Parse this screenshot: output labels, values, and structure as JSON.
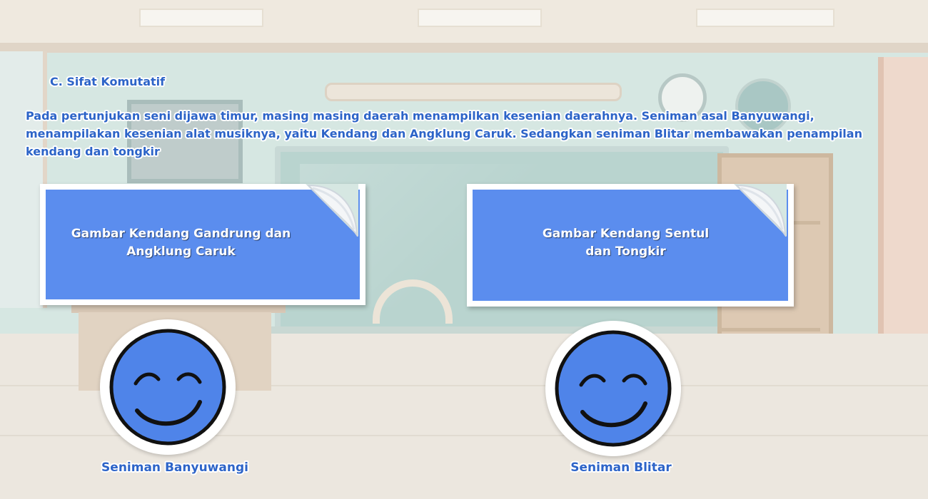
{
  "section": {
    "title": "C. Sifat Komutatif"
  },
  "question": {
    "text": "Pada pertunjukan seni dijawa timur, masing masing daerah menampilkan kesenian daerahnya. Seniman asal Banyuwangi, menampilakan kesenian alat musiknya, yaitu Kendang dan Angklung Caruk. Sedangkan seniman Blitar membawakan penampilan kendang dan tongkir"
  },
  "cards": [
    {
      "line1": "Gambar Kendang Gandrung dan",
      "line2": "Angklung Caruk"
    },
    {
      "line1": "Gambar Kendang Sentul",
      "line2": "dan Tongkir"
    }
  ],
  "characters": [
    {
      "label": "Seniman Banyuwangi"
    },
    {
      "label": "Seniman Blitar"
    }
  ],
  "colors": {
    "card_fill": "#5b8dee",
    "face_fill": "#4f84e9",
    "text_accent": "#2d64c8"
  },
  "icons": [
    "smiley-face-icon",
    "page-curl-icon"
  ]
}
